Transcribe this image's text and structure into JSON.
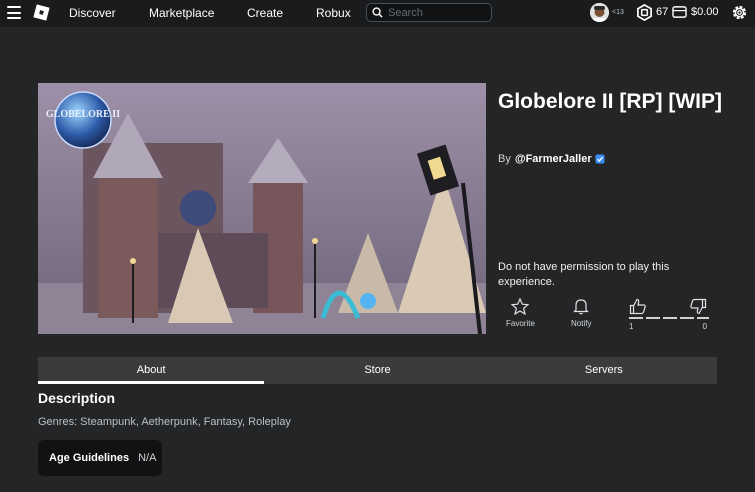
{
  "nav": {
    "links": [
      "Discover",
      "Marketplace",
      "Create",
      "Robux"
    ],
    "search_placeholder": "Search",
    "avatar_age": "<13",
    "robux_count": "67",
    "wallet_amount": "$0.00"
  },
  "game": {
    "title": "Globelore II [RP] [WIP]",
    "by_label": "By",
    "creator": "@FarmerJaller",
    "permission_message": "Do not have permission to play this experience.",
    "thumbnail_logo_text": "GLOBELORE II"
  },
  "actions": {
    "favorite_label": "Favorite",
    "notify_label": "Notify",
    "upvotes": "1",
    "downvotes": "0"
  },
  "tabs": [
    {
      "label": "About",
      "active": true
    },
    {
      "label": "Store",
      "active": false
    },
    {
      "label": "Servers",
      "active": false
    }
  ],
  "about": {
    "description_heading": "Description",
    "genres": "Genres: Steampunk, Aetherpunk, Fantasy, Roleplay",
    "age_label": "Age Guidelines",
    "age_value": "N/A"
  },
  "colors": {
    "background": "#232527",
    "topbar": "#191b1d",
    "tab_bar": "#393b3d",
    "verified_blue": "#3b8ff5"
  }
}
